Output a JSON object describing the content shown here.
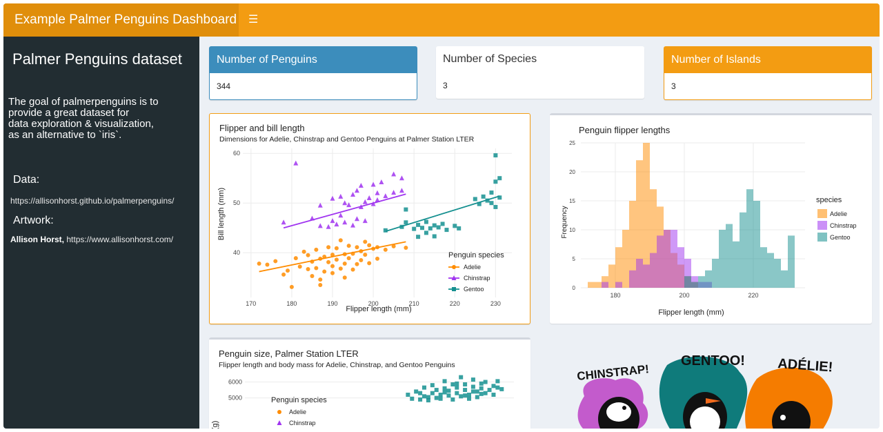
{
  "app_title": "Example Palmer Penguins Dashboard",
  "sidebar": {
    "title": "Palmer Penguins dataset",
    "description": "The goal of palmerpenguins is to\nprovide a great dataset for\ndata exploration & visualization,\nas an alternative to `iris`.",
    "data_heading": "Data:",
    "data_link": "https://allisonhorst.github.io/palmerpenguins/",
    "artwork_heading": "Artwork:",
    "artwork_author": "Allison Horst,",
    "artwork_link": "https://www.allisonhorst.com/"
  },
  "value_boxes": [
    {
      "title": "Number of Penguins",
      "value": "344",
      "color": "#3c8dbc"
    },
    {
      "title": "Number of Species",
      "value": "3",
      "color": "#ffffff"
    },
    {
      "title": "Number of Islands",
      "value": "3",
      "color": "#f39c12"
    }
  ],
  "colors": {
    "Adelie": "#ff8c00",
    "Chinstrap": "#a034f0",
    "Gentoo": "#159090"
  },
  "chart_data": [
    {
      "type": "scatter",
      "title": "Flipper and bill length",
      "subtitle": "Dimensions for Adelie, Chinstrap and Gentoo Penguins at Palmer Station LTER",
      "xlabel": "Flipper length (mm)",
      "ylabel": "Bill length (mm)",
      "xlim": [
        168,
        234
      ],
      "ylim": [
        31,
        61
      ],
      "xticks": [
        170,
        180,
        190,
        200,
        210,
        220,
        230
      ],
      "yticks": [
        40,
        50,
        60
      ],
      "grid": true,
      "legend_title": "Penguin species",
      "legend_position": "bottom-right",
      "series": [
        {
          "name": "Adelie",
          "marker": "circle",
          "points": [
            [
              172,
              37.8
            ],
            [
              174,
              37.6
            ],
            [
              176,
              38.3
            ],
            [
              178,
              35.6
            ],
            [
              179,
              36.4
            ],
            [
              180,
              33.1
            ],
            [
              181,
              38.9
            ],
            [
              182,
              37.2
            ],
            [
              183,
              40.2
            ],
            [
              184,
              36.7
            ],
            [
              184,
              39.5
            ],
            [
              185,
              35.3
            ],
            [
              185,
              38.2
            ],
            [
              186,
              36.9
            ],
            [
              186,
              40.6
            ],
            [
              187,
              34.6
            ],
            [
              187,
              38.8
            ],
            [
              188,
              39.2
            ],
            [
              188,
              36.2
            ],
            [
              189,
              41.1
            ],
            [
              189,
              38.1
            ],
            [
              190,
              39.6
            ],
            [
              190,
              37.3
            ],
            [
              190,
              35.9
            ],
            [
              191,
              40.9
            ],
            [
              191,
              38.6
            ],
            [
              192,
              36.8
            ],
            [
              192,
              42.5
            ],
            [
              193,
              39.7
            ],
            [
              193,
              37.8
            ],
            [
              194,
              41.4
            ],
            [
              194,
              38.9
            ],
            [
              195,
              36.6
            ],
            [
              195,
              39.8
            ],
            [
              196,
              41.1
            ],
            [
              196,
              37.7
            ],
            [
              197,
              40.3
            ],
            [
              197,
              38.5
            ],
            [
              198,
              42.2
            ],
            [
              198,
              39.6
            ],
            [
              199,
              41.5
            ],
            [
              199,
              37.9
            ],
            [
              200,
              40.8
            ],
            [
              201,
              41.1
            ],
            [
              201,
              38.8
            ],
            [
              203,
              40.6
            ],
            [
              205,
              41.3
            ],
            [
              208,
              41.0
            ],
            [
              193,
              35.0
            ],
            [
              187,
              33.5
            ]
          ],
          "trend": [
            [
              172,
              36.2
            ],
            [
              208,
              42.2
            ]
          ]
        },
        {
          "name": "Chinstrap",
          "marker": "triangle",
          "points": [
            [
              178,
              46.1
            ],
            [
              181,
              58.0
            ],
            [
              185,
              46.9
            ],
            [
              187,
              45.4
            ],
            [
              187,
              49.5
            ],
            [
              189,
              45.2
            ],
            [
              190,
              46.4
            ],
            [
              190,
              50.9
            ],
            [
              191,
              45.7
            ],
            [
              192,
              47.5
            ],
            [
              192,
              51.3
            ],
            [
              193,
              46.1
            ],
            [
              193,
              50.0
            ],
            [
              194,
              49.6
            ],
            [
              195,
              45.5
            ],
            [
              195,
              51.7
            ],
            [
              196,
              46.8
            ],
            [
              196,
              52.5
            ],
            [
              197,
              49.2
            ],
            [
              197,
              53.5
            ],
            [
              198,
              50.2
            ],
            [
              198,
              46.4
            ],
            [
              199,
              51.0
            ],
            [
              200,
              49.8
            ],
            [
              200,
              53.7
            ],
            [
              201,
              52.0
            ],
            [
              201,
              50.6
            ],
            [
              202,
              54.2
            ],
            [
              203,
              51.4
            ],
            [
              205,
              52.1
            ],
            [
              205,
              55.8
            ],
            [
              207,
              55.0
            ],
            [
              207,
              52.5
            ]
          ],
          "trend": [
            [
              178,
              45.0
            ],
            [
              208,
              51.8
            ]
          ]
        },
        {
          "name": "Gentoo",
          "marker": "square",
          "points": [
            [
              203,
              44.5
            ],
            [
              207,
              45.2
            ],
            [
              208,
              46.1
            ],
            [
              208,
              48.7
            ],
            [
              210,
              44.8
            ],
            [
              211,
              45.6
            ],
            [
              211,
              43.2
            ],
            [
              212,
              45.0
            ],
            [
              213,
              46.2
            ],
            [
              213,
              44.0
            ],
            [
              214,
              44.9
            ],
            [
              215,
              45.5
            ],
            [
              215,
              43.3
            ],
            [
              216,
              45.1
            ],
            [
              217,
              45.8
            ],
            [
              218,
              44.6
            ],
            [
              220,
              45.4
            ],
            [
              221,
              44.9
            ],
            [
              225,
              50.8
            ],
            [
              226,
              49.8
            ],
            [
              227,
              51.3
            ],
            [
              228,
              50.5
            ],
            [
              229,
              50.0
            ],
            [
              229,
              52.1
            ],
            [
              230,
              49.2
            ],
            [
              230,
              54.3
            ],
            [
              231,
              51.1
            ],
            [
              230,
              59.6
            ],
            [
              231,
              55.0
            ]
          ],
          "trend": [
            [
              203,
              44.3
            ],
            [
              231,
              51.4
            ]
          ]
        }
      ]
    },
    {
      "type": "bar",
      "title": "Penguin flipper lengths",
      "xlabel": "Flipper length (mm)",
      "ylabel": "Frequency",
      "xlim": [
        170,
        235
      ],
      "ylim": [
        0,
        25
      ],
      "xticks": [
        180,
        200,
        220
      ],
      "yticks": [
        0,
        5,
        10,
        15,
        20,
        25
      ],
      "grid": true,
      "legend_title": "species",
      "legend_position": "right",
      "bin_start": 172,
      "bin_width": 2,
      "series": [
        {
          "name": "Adelie",
          "values": [
            1,
            1,
            2,
            4,
            7,
            10,
            15,
            22,
            25,
            17,
            14,
            10,
            6,
            4,
            2,
            1,
            0,
            0,
            0,
            0,
            0,
            0,
            0,
            0,
            0,
            0,
            0,
            0,
            0,
            0
          ]
        },
        {
          "name": "Chinstrap",
          "values": [
            0,
            0,
            1,
            0,
            1,
            0,
            3,
            5,
            4,
            6,
            9,
            10,
            10,
            7,
            5,
            2,
            1,
            1,
            0,
            0,
            0,
            0,
            0,
            0,
            0,
            0,
            0,
            0,
            0,
            0
          ]
        },
        {
          "name": "Gentoo",
          "values": [
            0,
            0,
            0,
            0,
            0,
            0,
            0,
            0,
            0,
            0,
            0,
            0,
            0,
            0,
            2,
            1,
            2,
            3,
            5,
            10,
            11,
            8,
            13,
            17,
            15,
            7,
            6,
            5,
            3,
            9
          ]
        }
      ]
    },
    {
      "type": "scatter",
      "title": "Penguin size, Palmer Station LTER",
      "subtitle": "Flipper length and body mass for Adelie, Chinstrap, and Gentoo Penguins",
      "xlabel": "",
      "ylabel": "",
      "xlim": [
        168,
        234
      ],
      "ylim": [
        2600,
        6500
      ],
      "yticks": [
        5000,
        6000
      ],
      "grid": true,
      "legend_title": "Penguin species",
      "legend_position": "top-left",
      "series": [
        {
          "name": "Adelie",
          "marker": "circle",
          "points": []
        },
        {
          "name": "Chinstrap",
          "marker": "triangle",
          "points": []
        },
        {
          "name": "Gentoo",
          "marker": "square",
          "points": [
            [
              208,
              5200
            ],
            [
              209,
              4950
            ],
            [
              210,
              5400
            ],
            [
              211,
              4900
            ],
            [
              212,
              5100
            ],
            [
              212,
              5650
            ],
            [
              213,
              4850
            ],
            [
              214,
              5300
            ],
            [
              214,
              5800
            ],
            [
              215,
              5000
            ],
            [
              215,
              5500
            ],
            [
              216,
              4950
            ],
            [
              216,
              5200
            ],
            [
              217,
              5600
            ],
            [
              217,
              6050
            ],
            [
              218,
              5150
            ],
            [
              218,
              5450
            ],
            [
              219,
              5850
            ],
            [
              219,
              4900
            ],
            [
              220,
              5300
            ],
            [
              220,
              5650
            ],
            [
              221,
              5100
            ],
            [
              221,
              6300
            ],
            [
              222,
              5500
            ],
            [
              222,
              5850
            ],
            [
              223,
              5200
            ],
            [
              223,
              4950
            ],
            [
              224,
              5700
            ],
            [
              224,
              6150
            ],
            [
              225,
              5400
            ],
            [
              225,
              5050
            ],
            [
              226,
              5600
            ],
            [
              226,
              5900
            ],
            [
              227,
              5300
            ],
            [
              227,
              6000
            ],
            [
              228,
              5500
            ],
            [
              229,
              5750
            ],
            [
              230,
              5650
            ],
            [
              230,
              6050
            ],
            [
              231,
              5550
            ],
            [
              229,
              5200
            ],
            [
              213,
              5050
            ],
            [
              211,
              5300
            ],
            [
              217,
              5350
            ],
            [
              220,
              5900
            ],
            [
              222,
              5150
            ],
            [
              224,
              5400
            ],
            [
              226,
              5250
            ]
          ]
        }
      ]
    }
  ],
  "artwork": {
    "label_chinstrap": "CHINSTRAP!",
    "label_gentoo": "GENTOO!",
    "label_adelie": "ADÉLIE!"
  }
}
